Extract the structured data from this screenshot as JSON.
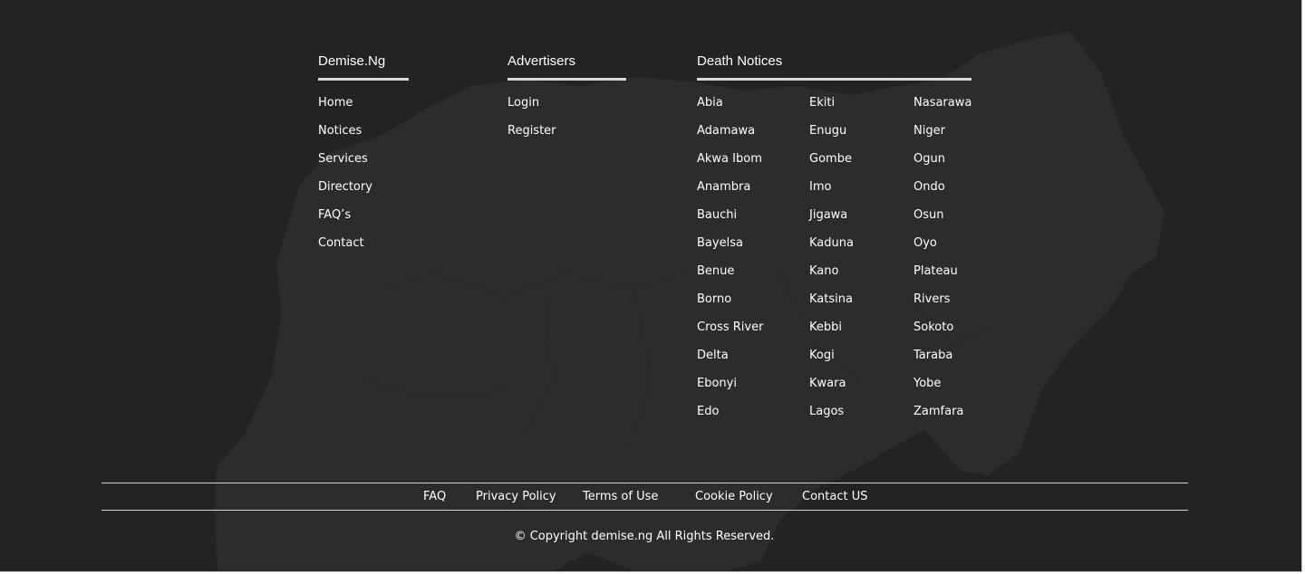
{
  "brand": {
    "title": "Demise.Ng",
    "links": [
      "Home",
      "Notices",
      "Services",
      "Directory",
      "FAQ’s",
      "Contact"
    ]
  },
  "advertisers": {
    "title": "Advertisers",
    "links": [
      "Login",
      "Register"
    ]
  },
  "death_notices": {
    "title": "Death Notices",
    "col1": [
      "Abia",
      "Adamawa",
      "Akwa Ibom",
      "Anambra",
      "Bauchi",
      "Bayelsa",
      "Benue",
      "Borno",
      "Cross River",
      "Delta",
      "Ebonyi",
      "Edo"
    ],
    "col2": [
      "Ekiti",
      "Enugu",
      "Gombe",
      "Imo",
      "Jigawa",
      "Kaduna",
      "Kano",
      "Katsina",
      "Kebbi",
      "Kogi",
      "Kwara",
      "Lagos"
    ],
    "col3": [
      "Nasarawa",
      "Niger",
      "Ogun",
      "Ondo",
      "Osun",
      "Oyo",
      "Plateau",
      "Rivers",
      "Sokoto",
      "Taraba",
      "Yobe",
      "Zamfara"
    ]
  },
  "bottom_links": {
    "faq": "FAQ",
    "privacy": "Privacy Policy",
    "terms": "Terms of Use",
    "cookie": "Cookie Policy",
    "contact": "Contact US"
  },
  "copyright": "© Copyright demise.ng All Rights Reserved.",
  "colors": {
    "background": "#222325",
    "map_fill": "#2c2c2c",
    "text": "#ffffff",
    "rule": "#d9d9d9"
  }
}
